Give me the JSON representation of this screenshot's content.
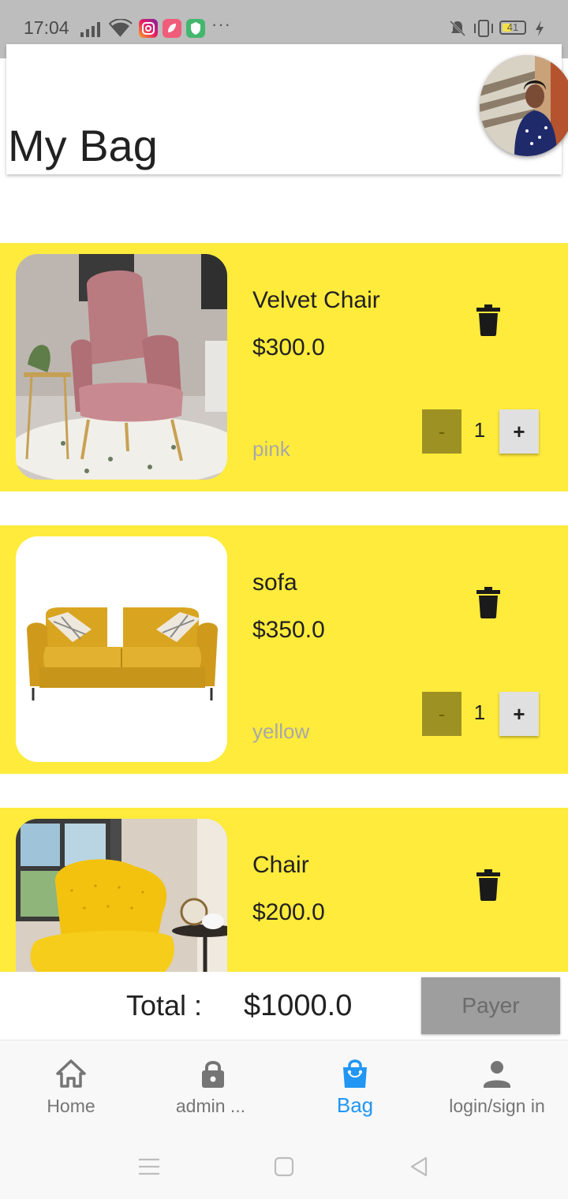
{
  "status_bar": {
    "time": "17:04",
    "more": "···",
    "battery_level": "41"
  },
  "header": {
    "title": "My Bag"
  },
  "cart": {
    "items": [
      {
        "name": "Velvet Chair",
        "price": "$300.0",
        "color": "pink",
        "quantity": "1",
        "minus_label": "-",
        "plus_label": "+"
      },
      {
        "name": "sofa",
        "price": "$350.0",
        "color": "yellow",
        "quantity": "1",
        "minus_label": "-",
        "plus_label": "+"
      },
      {
        "name": "Chair",
        "price": "$200.0"
      }
    ]
  },
  "total": {
    "label": "Total :",
    "value": "$1000.0",
    "pay_label": "Payer"
  },
  "bottom_nav": {
    "items": [
      {
        "label": "Home",
        "icon": "home-icon"
      },
      {
        "label": "admin ...",
        "icon": "lock-icon"
      },
      {
        "label": "Bag",
        "icon": "shopping-bag-icon",
        "active": true
      },
      {
        "label": "login/sign in",
        "icon": "person-icon"
      }
    ]
  },
  "colors": {
    "card_background": "#ffeb3b",
    "accent_active": "#2196f3",
    "minus_button": "#9e9124",
    "pay_button": "#9e9e9e"
  }
}
